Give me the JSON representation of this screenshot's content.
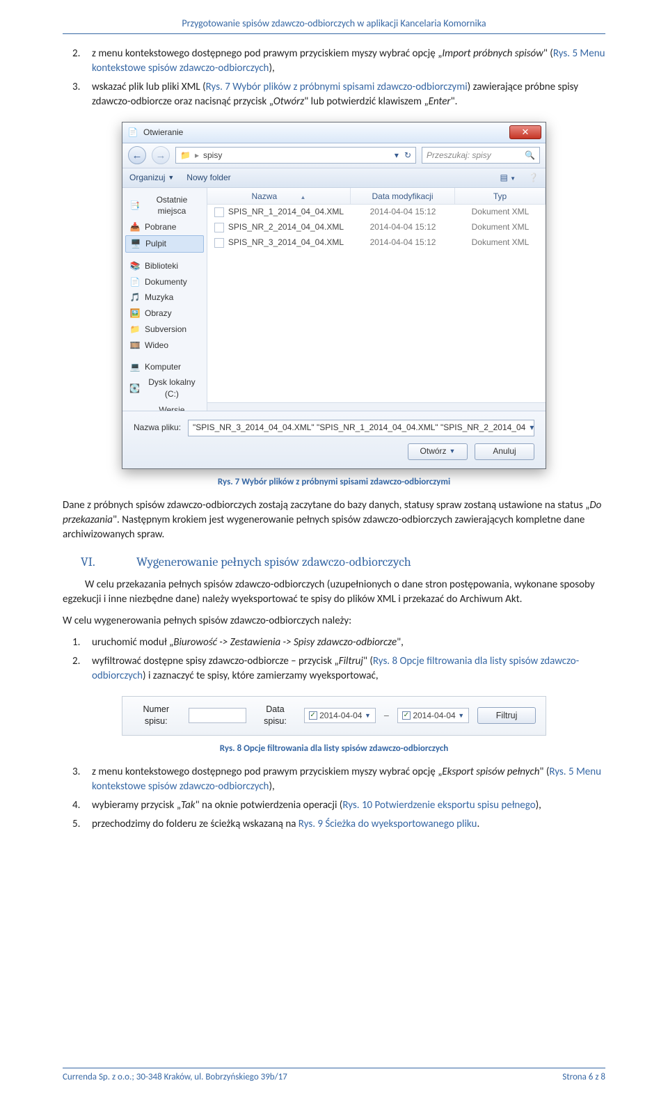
{
  "header": "Przygotowanie spisów zdawczo-odbiorczych w aplikacji Kancelaria Komornika",
  "topList": {
    "n2": "2.",
    "n3": "3.",
    "i2_a": "z menu kontekstowego dostępnego pod prawym przyciskiem myszy wybrać opcję „",
    "i2_b": "Import próbnych spisów",
    "i2_c": "\" (",
    "i2_ref": "Rys. 5 Menu kontekstowe spisów zdawczo-odbiorczych",
    "i2_d": "),",
    "i3_a": "wskazać plik lub pliki XML (",
    "i3_ref": "Rys. 7 Wybór plików z próbnymi spisami zdawczo-odbiorczymi",
    "i3_b": ") zawierające próbne spisy zdawczo-odbiorcze oraz nacisnąć przycisk „",
    "i3_c": "Otwórz",
    "i3_d": "\" lub potwierdzić klawiszem „",
    "i3_e": "Enter",
    "i3_f": "\"."
  },
  "dialog": {
    "title": "Otwieranie",
    "crumb_folder": "spisy",
    "search_placeholder": "Przeszukaj: spisy",
    "toolbar_organize": "Organizuj",
    "toolbar_newfolder": "Nowy folder",
    "sidebar": {
      "recent": "Ostatnie miejsca",
      "downloads": "Pobrane",
      "desktop": "Pulpit",
      "libraries": "Biblioteki",
      "documents": "Dokumenty",
      "music": "Muzyka",
      "pictures": "Obrazy",
      "subversion": "Subversion",
      "videos": "Wideo",
      "computer": "Komputer",
      "cdisk": "Dysk lokalny (C:)",
      "release": "Wersje Release (\\"
    },
    "columns": {
      "name": "Nazwa",
      "date": "Data modyfikacji",
      "type": "Typ"
    },
    "rows": [
      {
        "name": "SPIS_NR_1_2014_04_04.XML",
        "date": "2014-04-04 15:12",
        "type": "Dokument XML"
      },
      {
        "name": "SPIS_NR_2_2014_04_04.XML",
        "date": "2014-04-04 15:12",
        "type": "Dokument XML"
      },
      {
        "name": "SPIS_NR_3_2014_04_04.XML",
        "date": "2014-04-04 15:12",
        "type": "Dokument XML"
      }
    ],
    "filename_label": "Nazwa pliku:",
    "filename_value": "\"SPIS_NR_3_2014_04_04.XML\" \"SPIS_NR_1_2014_04_04.XML\" \"SPIS_NR_2_2014_04",
    "btn_open": "Otwórz",
    "btn_cancel": "Anuluj"
  },
  "figcap7": "Rys. 7 Wybór plików z próbnymi spisami zdawczo-odbiorczymi",
  "para2_a": "Dane z próbnych spisów zdawczo-odbiorczych zostają zaczytane do bazy danych, statusy spraw zostaną ustawione na status „",
  "para2_b": "Do przekazania",
  "para2_c": "\". Następnym krokiem jest wygenerowanie pełnych spisów zdawczo-odbiorczych zawierających kompletne dane archiwizowanych spraw.",
  "section6": {
    "num": "VI.",
    "title": "Wygenerowanie pełnych spisów zdawczo-odbiorczych"
  },
  "para3": "W celu przekazania pełnych spisów zdawczo-odbiorczych (uzupełnionych o dane stron postępowania, wykonane sposoby egzekucji i inne niezbędne dane) należy wyeksportować te spisy do plików XML i przekazać do Archiwum Akt.",
  "para4": "W celu wygenerowania pełnych spisów zdawczo-odbiorczych należy:",
  "midList": {
    "n1": "1.",
    "n2": "2.",
    "i1_a": "uruchomić moduł „",
    "i1_b": "Biurowość -> Zestawienia -> Spisy zdawczo-odbiorcze",
    "i1_c": "\",",
    "i2_a": "wyfiltrować dostępne spisy zdawczo-odbiorcze – przycisk „",
    "i2_b": "Filtruj",
    "i2_c": "\" (",
    "i2_ref": "Rys. 8 Opcje filtrowania dla listy spisów zdawczo-odbiorczych",
    "i2_d": ") i zaznaczyć te spisy, które zamierzamy wyeksportować,"
  },
  "filter": {
    "num_label": "Numer spisu:",
    "date_label": "Data spisu:",
    "date_from": "2014-04-04",
    "date_to": "2014-04-04",
    "btn": "Filtruj"
  },
  "figcap8": "Rys. 8 Opcje filtrowania dla listy spisów zdawczo-odbiorczych",
  "botList": {
    "n3": "3.",
    "n4": "4.",
    "n5": "5.",
    "i3_a": "z menu kontekstowego dostępnego pod prawym przyciskiem myszy wybrać opcję „",
    "i3_b": "Eksport spisów pełnych",
    "i3_c": "\" (",
    "i3_ref": "Rys. 5 Menu kontekstowe spisów zdawczo-odbiorczych",
    "i3_d": "),",
    "i4_a": "wybieramy przycisk „",
    "i4_b": "Tak",
    "i4_c": "\" na oknie potwierdzenia operacji (",
    "i4_ref": "Rys. 10 Potwierdzenie eksportu spisu pełnego",
    "i4_d": "),",
    "i5_a": "przechodzimy do folderu ze ścieżką wskazaną na ",
    "i5_ref": "Rys. 9 Ścieżka do wyeksportowanego pliku",
    "i5_b": "."
  },
  "footer": {
    "left": "Currenda Sp. z o.o.; 30-348 Kraków, ul. Bobrzyńskiego 39b/17",
    "right": "Strona 6 z 8"
  }
}
